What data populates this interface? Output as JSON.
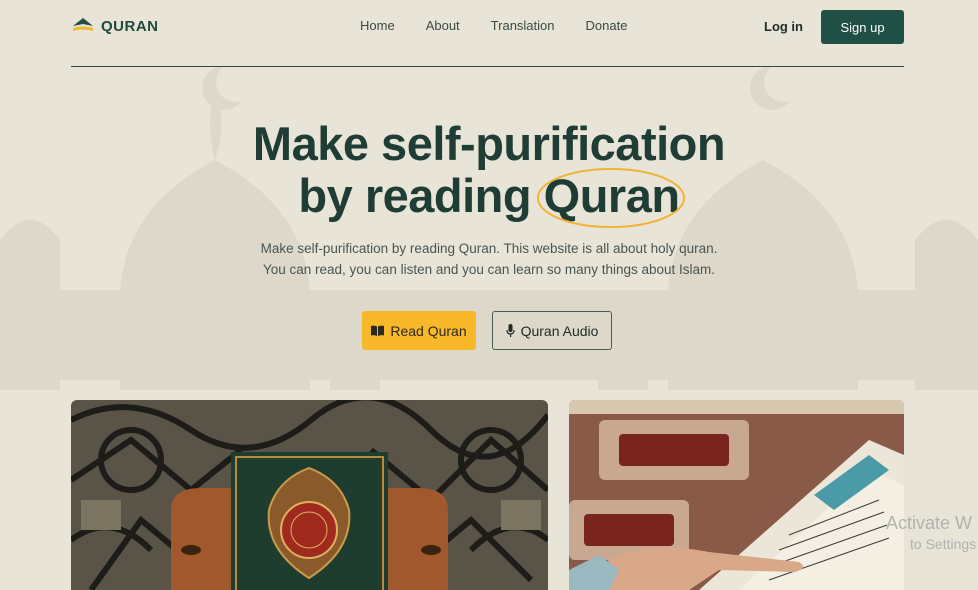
{
  "brand": {
    "name": "QURAN"
  },
  "nav": {
    "links": [
      {
        "label": "Home"
      },
      {
        "label": "About"
      },
      {
        "label": "Translation"
      },
      {
        "label": "Donate"
      }
    ],
    "login_label": "Log in",
    "signup_label": "Sign up"
  },
  "hero": {
    "headline_line1": "Make self-purification",
    "headline_line2_prefix": "by reading ",
    "headline_highlight": "Quran",
    "subtitle": "Make self-purification by reading Quran. This website is all about holy quran. You can read, you can listen and you can learn so many things about Islam.",
    "primary_button": {
      "label": "Read Quran",
      "icon": "book-icon"
    },
    "secondary_button": {
      "label": "Quran Audio",
      "icon": "microphone-icon"
    }
  },
  "images": [
    {
      "name": "quran-on-stand-photo"
    },
    {
      "name": "reading-quran-photo"
    }
  ],
  "os_watermark": {
    "line1": "Activate W",
    "line2": "to Settings"
  },
  "colors": {
    "background": "#e8e4d8",
    "primary": "#1f4f45",
    "accent": "#f7b82a",
    "heading": "#1f3d35"
  }
}
